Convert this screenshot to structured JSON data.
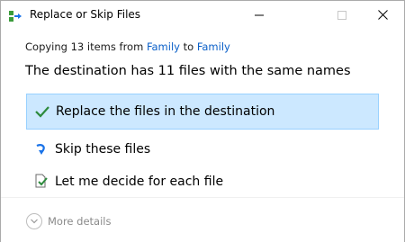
{
  "window": {
    "title": "Replace or Skip Files"
  },
  "dialog": {
    "copy_prefix": "Copying 13 items from",
    "source": "Family",
    "to_word": "to",
    "destination": "Family",
    "heading": "The destination has 11 files with the same names"
  },
  "options": [
    {
      "label": "Replace the files in the destination",
      "icon": "checkmark-icon",
      "selected": true
    },
    {
      "label": "Skip these files",
      "icon": "skip-arrow-icon",
      "selected": false
    },
    {
      "label": "Let me decide for each file",
      "icon": "decide-files-icon",
      "selected": false
    }
  ],
  "footer": {
    "more_details": "More details",
    "icon": "chevron-down-icon"
  },
  "colors": {
    "accent_link": "#0a5fc8",
    "selected_bg": "#cce8ff",
    "selected_border": "#99d1ff"
  }
}
